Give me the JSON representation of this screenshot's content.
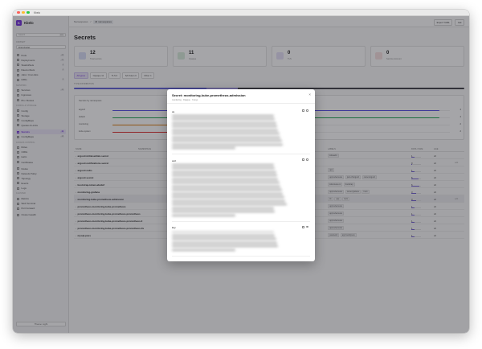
{
  "window": {
    "title": "Kbelo"
  },
  "sidebar": {
    "brand": "Kbelo",
    "search_placeholder": "Search",
    "search_kbd": "⌘K",
    "context_label": "CONTEXT",
    "context_value": "kind-cluster",
    "sections": [
      {
        "title": "",
        "items": [
          {
            "label": "Pods",
            "count": "28"
          },
          {
            "label": "Deployments",
            "count": "12"
          },
          {
            "label": "StatefulSets",
            "count": "3"
          },
          {
            "label": "DaemonSets",
            "count": "4"
          },
          {
            "label": "Jobs / CronJobs",
            "count": ""
          },
          {
            "label": "HPAs",
            "count": "2"
          }
        ]
      },
      {
        "title": "NETWORK",
        "items": [
          {
            "label": "Services",
            "count": "14"
          },
          {
            "label": "Ingresses",
            "count": ""
          },
          {
            "label": "IPs / Routes",
            "count": ""
          }
        ]
      },
      {
        "title": "CONFIG & STORAGE",
        "items": [
          {
            "label": "Config",
            "count": ""
          },
          {
            "label": "Storage",
            "count": ""
          },
          {
            "label": "ConfigMaps",
            "count": ""
          },
          {
            "label": "Quotas & Limits",
            "count": ""
          }
        ]
      },
      {
        "title": "",
        "items": [
          {
            "label": "Secrets",
            "count": "12",
            "active": true
          },
          {
            "label": "ConfigMaps",
            "count": "18"
          }
        ]
      },
      {
        "title": "ACCESS CONTROL",
        "items": [
          {
            "label": "Roles",
            "count": ""
          },
          {
            "label": "CRDs",
            "count": ""
          },
          {
            "label": "Helm",
            "count": ""
          },
          {
            "label": "Certificates",
            "count": ""
          }
        ]
      },
      {
        "title": "",
        "items": [
          {
            "label": "Nodes",
            "count": ""
          },
          {
            "label": "Network Policy",
            "count": ""
          },
          {
            "label": "Topology",
            "count": ""
          },
          {
            "label": "Events",
            "count": ""
          },
          {
            "label": "Logs",
            "count": ""
          }
        ]
      },
      {
        "title": "CLUSTER",
        "items": [
          {
            "label": "Metrics",
            "count": ""
          },
          {
            "label": "Web Terminal",
            "count": ""
          },
          {
            "label": "Port Forward",
            "count": ""
          }
        ]
      },
      {
        "title": "",
        "items": [
          {
            "label": "Cluster Health",
            "count": ""
          }
        ]
      }
    ],
    "footer": {
      "theme": "Theme: Light",
      "settings": "Settings"
    }
  },
  "topbar": {
    "crumbs": [
      "Namespaces",
      "All namespaces"
    ],
    "actions": [
      "Export YAML",
      "Ask"
    ]
  },
  "page": {
    "title": "Secrets",
    "stats": [
      {
        "value": "12",
        "label": "Total secrets",
        "color": "#d8ddf7"
      },
      {
        "value": "11",
        "label": "Opaque",
        "color": "#d7eddb"
      },
      {
        "value": "0",
        "label": "TLS",
        "color": "#e5e0f8"
      },
      {
        "value": "0",
        "label": "Service Account",
        "color": "#f8e0e0"
      }
    ],
    "filters": [
      {
        "label": "All types",
        "selected": true
      },
      {
        "label": "Opaque 11"
      },
      {
        "label": "TLS 0"
      },
      {
        "label": "SA Token 0"
      },
      {
        "label": "Other 1"
      }
    ],
    "distribution_label": "TYPE DISTRIBUTION",
    "distribution": [
      {
        "fraction": 0.34,
        "color": "#5b5bd6"
      },
      {
        "fraction": 0.08,
        "color": "#9b8fe0"
      },
      {
        "fraction": 0.58,
        "color": "#3a3a40"
      }
    ],
    "chart": {
      "title": "Secrets by namespace",
      "rows": [
        {
          "label": "argocd",
          "value": "4",
          "fraction": 0.97,
          "color": "#4f46e5"
        },
        {
          "label": "default",
          "value": "4",
          "fraction": 0.97,
          "color": "#16a34a"
        },
        {
          "label": "monitoring",
          "value": "2",
          "fraction": 0.55,
          "color": "#d97706"
        },
        {
          "label": "kube-system",
          "value": "2",
          "fraction": 0.55,
          "color": "#dc2626"
        }
      ]
    },
    "table": {
      "headers": {
        "name": "NAME",
        "namespace": "NAMESPACE",
        "labels": "LABELS",
        "data": "DATA / SIZE",
        "age": "AGE"
      },
      "rows": [
        {
          "name": "argocd-initial-admin-secret",
          "labels": [
            "kubeadm"
          ],
          "data": "1",
          "fill": 0.3,
          "age": "2d",
          "action": ""
        },
        {
          "name": "argocd-notifications-secret",
          "labels": [],
          "data": "0",
          "fill": 0.1,
          "age": "2d",
          "action": "edit"
        },
        {
          "name": "argocd-redis",
          "labels": [
            "app"
          ],
          "data": "1",
          "fill": 0.3,
          "age": "2d",
          "action": ""
        },
        {
          "name": "argocd-secret",
          "labels": [
            "app.kubernetes",
            "part-of=argocd",
            "name=argocd"
          ],
          "data": "5",
          "fill": 0.75,
          "age": "2d",
          "action": ""
        },
        {
          "name": "bootstrap-token-abcdef",
          "labels": [
            "kubernetes.io",
            "bootstrap"
          ],
          "data": "6",
          "fill": 0.85,
          "age": "2d",
          "action": ""
        },
        {
          "name": "monitoring-grafana",
          "labels": [
            "app.kubernetes",
            "name=grafana",
            "helm"
          ],
          "data": "3",
          "fill": 0.5,
          "age": "2d",
          "action": ""
        },
        {
          "name": "monitoring-kube-prometheus-admission",
          "labels": [
            "kb",
            "app",
            "helm"
          ],
          "data": "3",
          "fill": 0.5,
          "age": "2d",
          "action": "edit",
          "highlight": true
        },
        {
          "name": "prometheus-monitoring-kube-prometheus",
          "labels": [
            "app.kubernetes"
          ],
          "data": "1",
          "fill": 0.3,
          "age": "2d",
          "action": ""
        },
        {
          "name": "prometheus-monitoring-kube-prometheus-prometheus",
          "labels": [
            "app.kubernetes"
          ],
          "data": "1",
          "fill": 0.3,
          "age": "2d",
          "action": ""
        },
        {
          "name": "prometheus-monitoring-kube-prometheus-prometheus-0",
          "labels": [
            "app.kubernetes"
          ],
          "data": "1",
          "fill": 0.3,
          "age": "2d",
          "action": ""
        },
        {
          "name": "prometheus-monitoring-kube-prometheus-prometheus-tls",
          "labels": [
            "app.kubernetes"
          ],
          "data": "1",
          "fill": 0.3,
          "age": "2d",
          "action": ""
        },
        {
          "name": "mysql-pass",
          "labels": [
            "password",
            "app=wordpress"
          ],
          "data": "1",
          "fill": 0.3,
          "age": "2d",
          "action": ""
        }
      ]
    }
  },
  "modal": {
    "title": "Secret: monitoring-kube-prometheus-admission",
    "subtitle": "monitoring · Opaque · 3 keys",
    "close": "×",
    "entries": [
      {
        "key": "ca",
        "lines": 10
      },
      {
        "key": "cert",
        "lines": 15
      },
      {
        "key": "key",
        "lines": 6
      }
    ]
  }
}
